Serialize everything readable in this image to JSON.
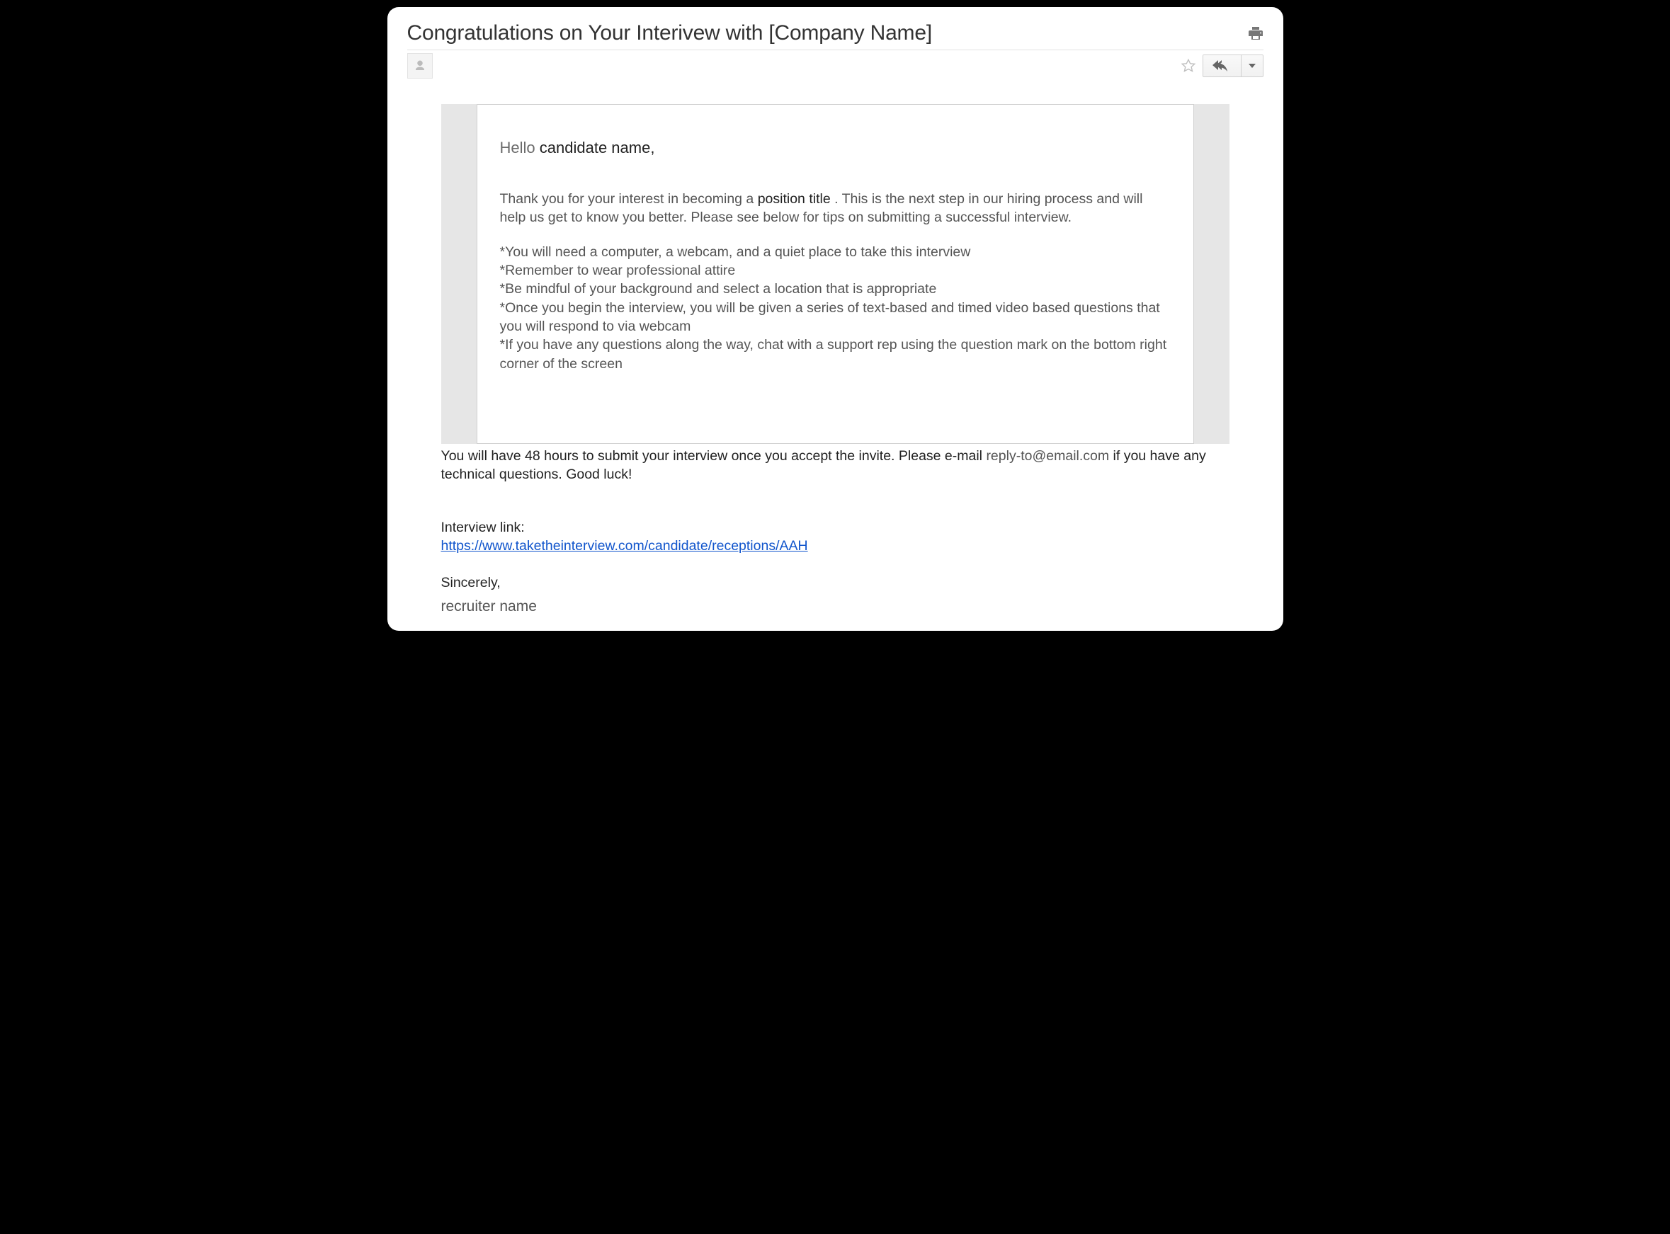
{
  "subject": "Congratulations on Your Interivew with [Company Name]",
  "greeting": {
    "hello": "Hello",
    "candidate_name": "candidate name,"
  },
  "intro": {
    "before_position": "Thank you for your interest in becoming a  ",
    "position_title": "position title",
    "after_position": "  . This is the next step in our hiring process and will help us get to know you better. Please see below for tips on submitting a successful interview."
  },
  "tips": [
    "*You will need a computer, a webcam, and a quiet place to take this interview",
    "*Remember to wear professional attire",
    "*Be mindful of your background and select a location that is appropriate",
    "*Once you begin the interview, you will be given a series of text-based and timed video based questions that you will respond to via webcam",
    "*If you have any questions along the way, chat with a support rep using the question mark on the bottom right corner of the screen"
  ],
  "footer": {
    "before_email": "You will have 48 hours to submit your interview once you accept the invite. Please e-mail   ",
    "reply_email": "reply-to@email.com",
    "after_email": "       if you have any technical questions. Good luck!"
  },
  "link_label": "Interview link:",
  "interview_link": "https://www.taketheinterview.com/candidate/receptions/AAH",
  "signoff": "Sincerely,",
  "recruiter_name": "recruiter name"
}
